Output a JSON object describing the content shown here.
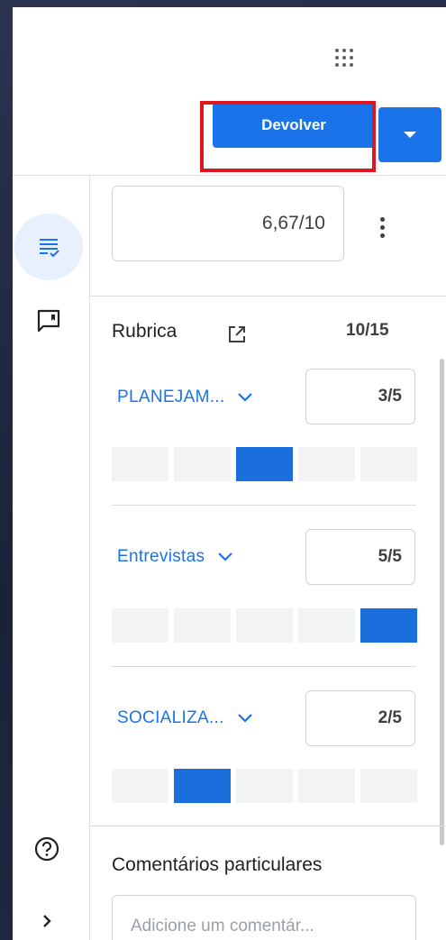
{
  "toolbar": {
    "return_label": "Devolver"
  },
  "grade": {
    "value": "6,67/10"
  },
  "rubric": {
    "title": "Rubrica",
    "total": "10/15",
    "criteria": [
      {
        "name": "PLANEJAM...",
        "score": "3/5",
        "selected_level": 3,
        "levels": 5
      },
      {
        "name": "Entrevistas",
        "score": "5/5",
        "selected_level": 5,
        "levels": 5
      },
      {
        "name": "SOCIALIZA...",
        "score": "2/5",
        "selected_level": 2,
        "levels": 5
      }
    ]
  },
  "private_comments": {
    "title": "Comentários particulares",
    "placeholder": "Adicione um comentár..."
  },
  "icons": {
    "apps": "apps-grid-icon",
    "grade_tab": "grading-list-icon",
    "comments_tab": "comment-icon",
    "help": "help-icon",
    "expand": "chevron-right-icon",
    "open_rubric": "open-in-new-icon",
    "dropdown": "caret-down-icon",
    "criterion_toggle": "chevron-down-icon"
  },
  "colors": {
    "accent": "#1a73e8",
    "highlight": "#e0161f",
    "level_selected": "#1a6fdc",
    "level_empty": "#f1f3f4"
  }
}
